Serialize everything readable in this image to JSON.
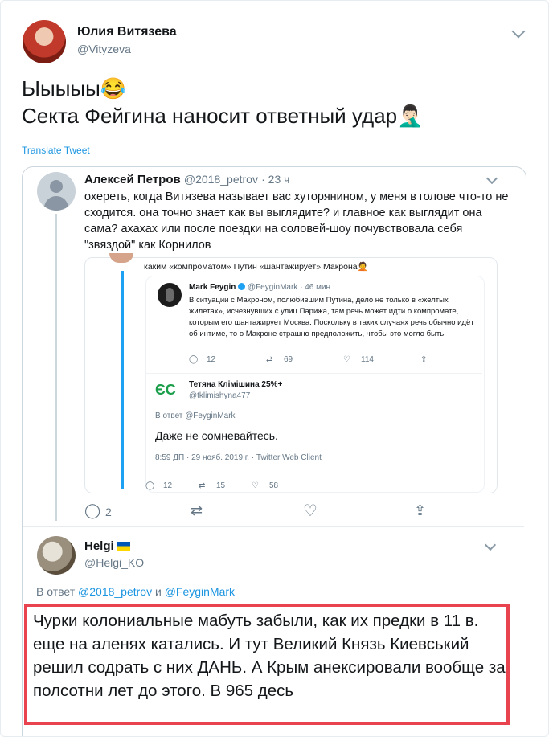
{
  "main_tweet": {
    "author_name": "Юлия Витязева",
    "author_handle": "@Vityzeva",
    "text_line1": "Ыыыыы😂",
    "text_line2": "Секта Фейгина наносит ответный удар🤦🏻‍♂️",
    "translate_label": "Translate Tweet"
  },
  "quoted": {
    "author_name": "Алексей Петров",
    "author_handle": "@2018_petrov",
    "time": "· 23 ч",
    "text": "охереть, когда Витязева называет вас хуторянином, у меня в голове что-то не сходится. она точно знает как вы выглядите? и главное как выглядит она сама? ахахах или после поездки на соловей-шоу почувствовала себя \"звяздой\" как Корнилов",
    "screenshot": {
      "top_text": "каким «компроматом» Путин «шантажирует» Макрона🤦",
      "feygin_name": "Mark Feygin",
      "feygin_meta": "@FeyginMark · 46 мин",
      "feygin_text": "В ситуации с Макроном, полюбившим Путина, дело не только в «желтых жилетах», исчезнувших с улиц Парижа, там речь может идти о компромате, которым его шантажирует Москва. Поскольку в таких случаях речь обычно идёт об интиме, то о Макроне страшно предположить, чтобы это могло быть.",
      "feygin_replies": "12",
      "feygin_retweets": "69",
      "feygin_likes": "114",
      "reply_name": "Тетяна Клімішина 25%+",
      "reply_handle": "@tklimishyna477",
      "reply_to": "В ответ @FeyginMark",
      "reply_text": "Даже не сомневайтесь.",
      "reply_meta": "8:59 ДП · 29 нояб. 2019 г. · Twitter Web Client",
      "outer_replies": "12",
      "outer_retweets": "15",
      "outer_likes": "58",
      "es_logo": "ЄС"
    },
    "reply_count": "2"
  },
  "reply": {
    "author_name": "Helgi",
    "author_handle": "@Helgi_KO",
    "reply_prefix": "В ответ",
    "reply_to_1": "@2018_petrov",
    "reply_and": "и",
    "reply_to_2": "@FeyginMark",
    "text": "Чурки колониальные мабуть забыли, как их предки в 11 в. еще на аленях катались. И тут Великий Князь Киевський решил содрать с них ДАНЬ. А Крым анексировали вообще за полсотни лет до этого. В 965 десь"
  },
  "colors": {
    "link": "#1b95e0",
    "highlight_border": "#e8434f",
    "ukraine_blue": "#0057b7",
    "ukraine_yellow": "#ffd700"
  }
}
